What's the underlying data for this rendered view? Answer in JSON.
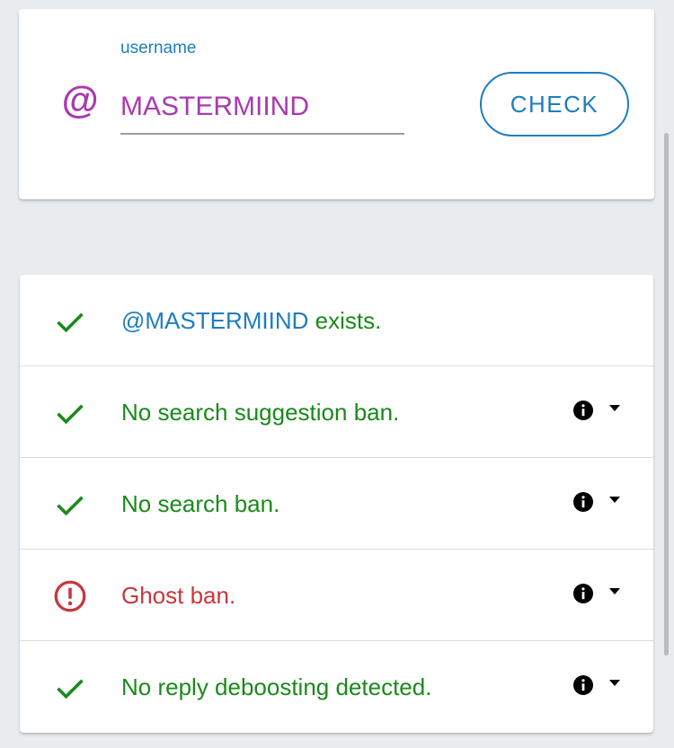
{
  "search": {
    "label": "username",
    "value": "MASTERMIIND",
    "at_symbol": "@",
    "button_label": "CHECK"
  },
  "results": {
    "exists": {
      "handle": "@MASTERMIIND",
      "suffix": " exists.",
      "status": "ok"
    },
    "items": [
      {
        "text": "No search suggestion ban.",
        "status": "ok"
      },
      {
        "text": "No search ban.",
        "status": "ok"
      },
      {
        "text": "Ghost ban.",
        "status": "warning"
      },
      {
        "text": "No reply deboosting detected.",
        "status": "ok"
      }
    ]
  },
  "colors": {
    "accent_blue": "#1e7dc0",
    "accent_purple": "#a93ab0",
    "success_green": "#1a8a1a",
    "danger_red": "#c8373d",
    "background": "#e8ecef"
  },
  "icons": {
    "at": "at-icon",
    "ok": "checkmark-icon",
    "warning": "exclamation-circle-icon",
    "info": "info-icon",
    "caret": "caret-down-icon"
  }
}
